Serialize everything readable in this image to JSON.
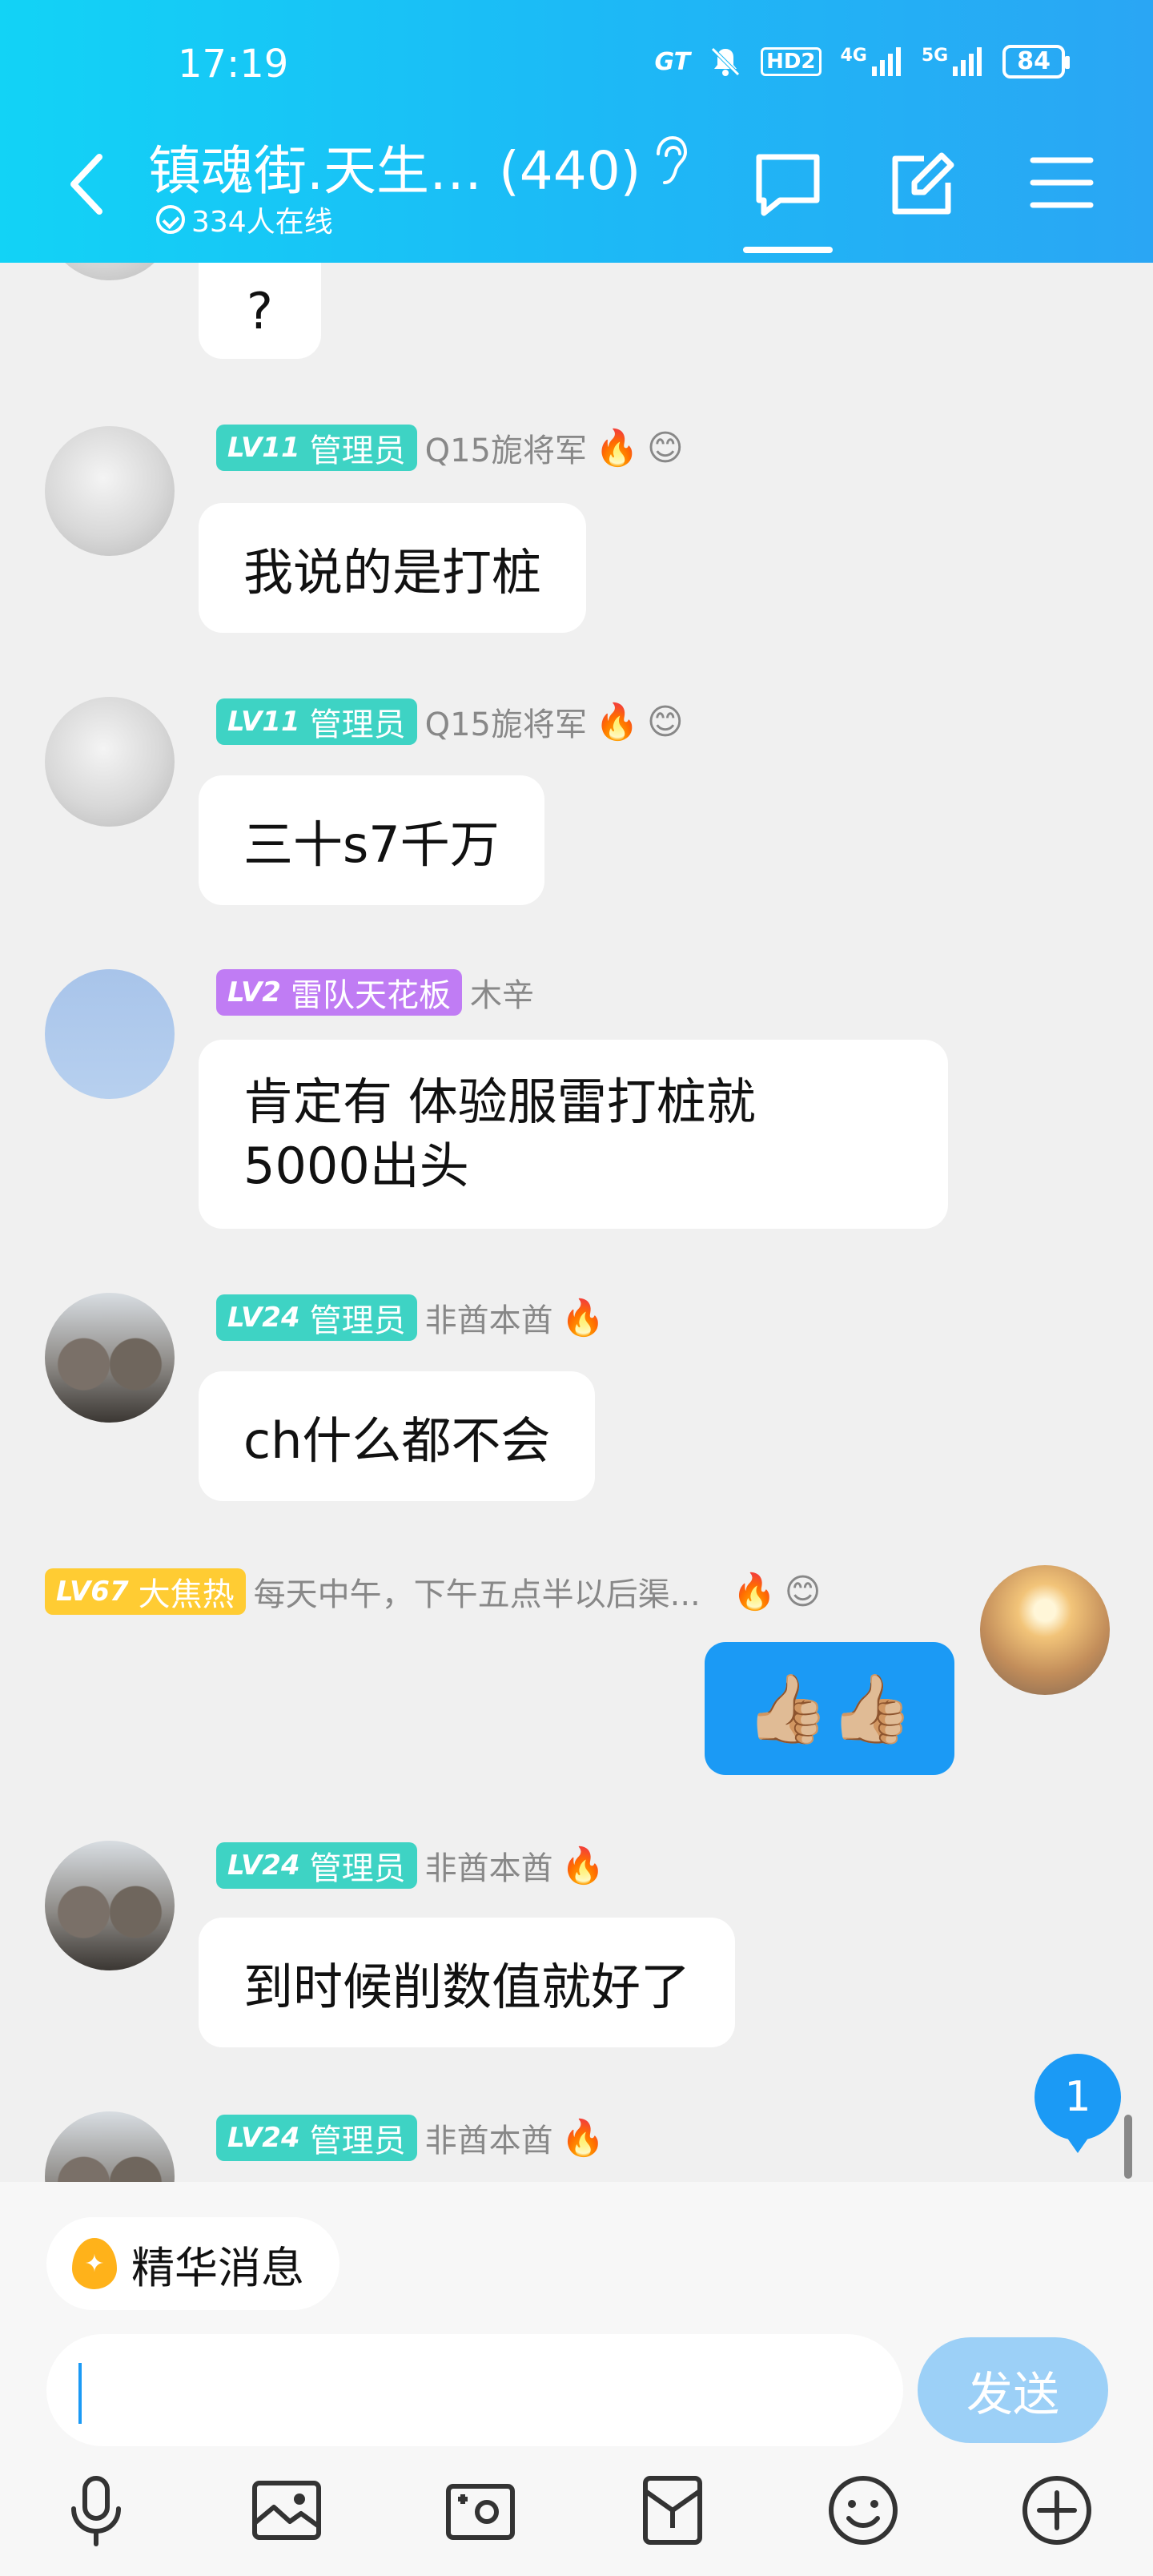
{
  "status_bar": {
    "time": "17:19",
    "network_label": "GT",
    "hd_label": "HD2",
    "net_4g": "4G",
    "net_5g": "5G",
    "battery": "84"
  },
  "header": {
    "title": "镇魂街.天生…  (440)",
    "online": "334人在线"
  },
  "messages": [
    {
      "partial_text": "?"
    },
    {
      "level": "LV11",
      "role": "管理员",
      "name": "Q15旎将军",
      "text": "我说的是打桩"
    },
    {
      "level": "LV11",
      "role": "管理员",
      "name": "Q15旎将军",
      "text": "三十s7千万"
    },
    {
      "level": "LV2",
      "role": "雷队天花板",
      "name": "木辛",
      "text_line1": "肯定有 体验服雷打桩就",
      "text_line2": "5000出头"
    },
    {
      "level": "LV24",
      "role": "管理员",
      "name": "非酋本酋",
      "text": "ch什么都不会"
    },
    {
      "level": "LV67",
      "role": "大焦热",
      "name": "每天中午，下午五点半以后渠...",
      "text": "👍🏼👍🏼"
    },
    {
      "level": "LV24",
      "role": "管理员",
      "name": "非酋本酋",
      "text": "到时候削数值就好了"
    },
    {
      "level": "LV24",
      "role": "管理员",
      "name": "非酋本酋"
    }
  ],
  "unread_count": "1",
  "bottom": {
    "essence_label": "精华消息",
    "input_value": "",
    "send_label": "发送"
  },
  "colors": {
    "header_start": "#12d3f6",
    "header_end": "#2aa6f4",
    "accent": "#1b9af5",
    "badge_admin": "#3ed3c4",
    "badge_purple": "#c07cf4",
    "badge_gold": "#ffcc33"
  }
}
